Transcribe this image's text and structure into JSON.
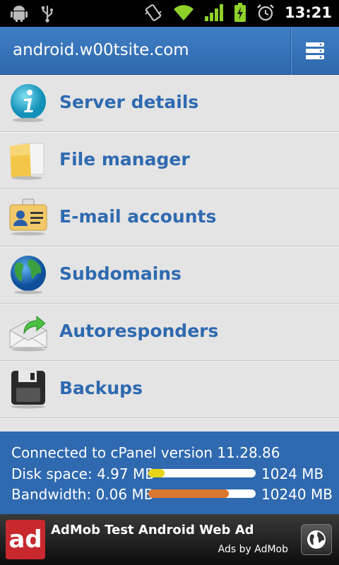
{
  "status_bar": {
    "time": "13:21",
    "icons": [
      "android-debug-icon",
      "usb-icon",
      "vibrate-icon",
      "wifi-icon",
      "signal-icon",
      "battery-charging-icon",
      "alarm-icon"
    ]
  },
  "header": {
    "title": "android.w00tsite.com",
    "menu_icon": "server-list-icon"
  },
  "menu_items": [
    {
      "label": "Server details",
      "icon": "info-icon"
    },
    {
      "label": "File manager",
      "icon": "folder-icon"
    },
    {
      "label": "E-mail accounts",
      "icon": "email-card-icon"
    },
    {
      "label": "Subdomains",
      "icon": "globe-icon"
    },
    {
      "label": "Autoresponders",
      "icon": "envelope-reply-icon"
    },
    {
      "label": "Backups",
      "icon": "floppy-disk-icon"
    }
  ],
  "info": {
    "connected": "Connected to cPanel version 11.28.86",
    "disk_label": "Disk space:",
    "disk_used": "4.97 MB",
    "disk_max": "1024 MB",
    "disk_fraction": 0.15,
    "bandwidth_label": "Bandwidth:",
    "bandwidth_used": "0.06 MB",
    "bandwidth_max": "10240 MB",
    "bandwidth_fraction": 0.75
  },
  "ad": {
    "logo": "ad",
    "title": "AdMob Test Android Web Ad",
    "by": "Ads by AdMob"
  },
  "colors": {
    "accent": "#2f69af",
    "label": "#2f6ab0",
    "disk_bar": "#e5d418",
    "bandwidth_bar": "#d9772e"
  }
}
